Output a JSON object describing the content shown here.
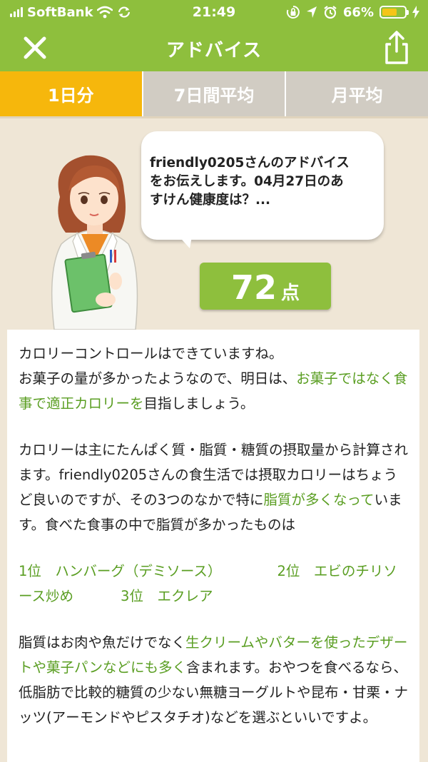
{
  "status_bar": {
    "carrier": "SoftBank",
    "time": "21:49",
    "battery": "66%",
    "battery_level": 0.66,
    "icons": [
      "signal-icon",
      "wifi-icon",
      "sync-icon",
      "rotation-lock-icon",
      "location-icon",
      "alarm-icon",
      "battery-icon",
      "charging-icon"
    ]
  },
  "nav": {
    "title": "アドバイス",
    "close_icon": "close-icon",
    "share_icon": "share-icon"
  },
  "tabs": [
    {
      "label": "1日分",
      "active": true
    },
    {
      "label": "7日間平均",
      "active": false
    },
    {
      "label": "月平均",
      "active": false
    }
  ],
  "advice": {
    "bubble_lines": [
      "friendly0205さんのアドバイス",
      "をお伝えします。04月27日のあ",
      "すけん健康度は？..."
    ],
    "score": "72",
    "score_unit": "点"
  },
  "body": {
    "p1_a": "カロリーコントロールはできていますね。",
    "p1_b": "お菓子の量が多かったようなので、明日は、",
    "p1_hl": "お菓子ではなく食事で適正カロリーを",
    "p1_c": "目指しましょう。",
    "p2_a": "カロリーは主にたんぱく質・脂質・糖質の摂取量から計算されます。friendly0205さんの食生活では摂取カロリーはちょうど良いのですが、その3つのなかで特に",
    "p2_hl": "脂質が多くなって",
    "p2_b": "います。食べた食事の中で脂質が多かったものは",
    "rank1": "1位　ハンバーグ（デミソース）",
    "rank2": "2位　エビのチリソース炒め",
    "rank3": "3位　エクレア",
    "p4_a": "脂質はお肉や魚だけでなく",
    "p4_hl": "生クリームやバターを使ったデザートや菓子パンなどにも多く",
    "p4_b": "含まれます。おやつを食べるなら、低脂肪で比較的糖質の少ない無糖ヨーグルトや昆布・甘栗・ナッツ(アーモンドやピスタチオ)などを選ぶといいですよ。"
  },
  "colors": {
    "header_green": "#8ebf3d",
    "active_tab": "#f6b70c",
    "inactive_tab": "#d1ccc3",
    "highlight_text": "#5a9e22",
    "background": "#efe6d6"
  }
}
